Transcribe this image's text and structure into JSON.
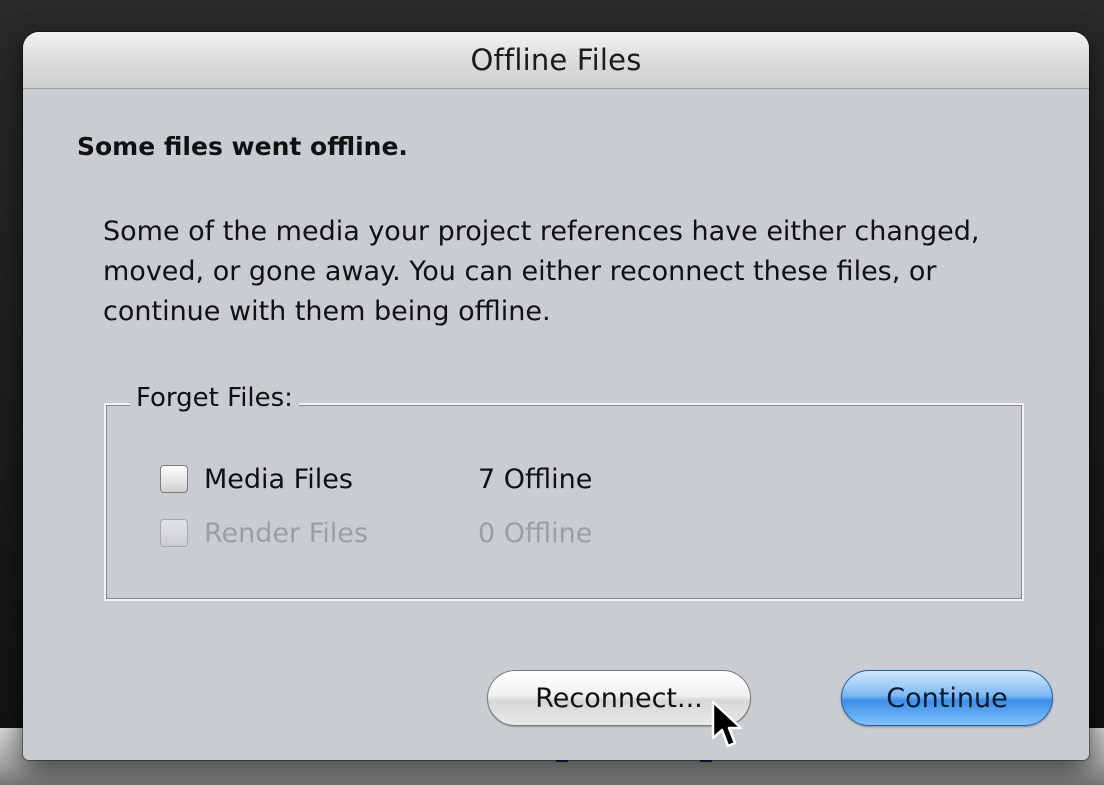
{
  "dialog": {
    "title": "Offline Files",
    "heading": "Some files went offline.",
    "message": "Some of the media your project references have either changed, moved, or gone away. You can either reconnect these files, or continue with them being offline."
  },
  "forget_files": {
    "legend": "Forget Files:",
    "rows": [
      {
        "label": "Media Files",
        "count": "7 Offline",
        "checked": false,
        "enabled": true
      },
      {
        "label": "Render Files",
        "count": "0 Offline",
        "checked": false,
        "enabled": false
      }
    ]
  },
  "buttons": {
    "reconnect": "Reconnect...",
    "continue": "Continue"
  },
  "icons": {
    "cursor": "arrow-cursor-icon"
  },
  "colors": {
    "dialog_bg": "#c9ccd1",
    "default_button": "#3d8ee6",
    "disabled_text": "#9b9ea3"
  }
}
